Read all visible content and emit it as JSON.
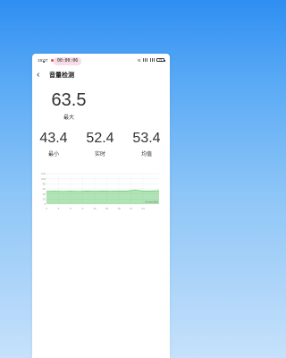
{
  "status_bar": {
    "time": "19:07",
    "icons": [
      "notification-icon",
      "nfc-icon",
      "wifi-icon",
      "signal-icon",
      "battery-icon"
    ],
    "battery": "73"
  },
  "header": {
    "back_icon": "chevron-left-icon",
    "title": "音量检测"
  },
  "timer": "00:00:06",
  "max": {
    "value": "63.5",
    "label": "最大"
  },
  "stats": [
    {
      "value": "43.4",
      "label": "最小"
    },
    {
      "value": "52.4",
      "label": "实时"
    },
    {
      "value": "53.4",
      "label": "均值"
    }
  ],
  "colors": {
    "accent": "#4fc45a",
    "timer_bg": "#f8dde7",
    "background_top": "#2f8ef2",
    "background_bottom": "#c6e1fb"
  },
  "chart_data": {
    "type": "area",
    "x": [
      0,
      2,
      4,
      6,
      8,
      10,
      12,
      14,
      16,
      18,
      20,
      22,
      24,
      26,
      28
    ],
    "values": [
      50,
      51,
      50,
      51,
      50,
      52,
      51,
      52,
      51,
      52,
      52,
      55,
      52,
      52,
      53
    ],
    "xticks": [
      "0",
      "3",
      "6",
      "9",
      "12",
      "15",
      "18",
      "21",
      "24"
    ],
    "yticks": [
      "120",
      "100",
      "80",
      "60",
      "40",
      "20",
      "0"
    ],
    "ylim": [
      0,
      120
    ],
    "xlim": [
      0,
      28
    ],
    "annotation": "Decibel(dB)",
    "grid": true,
    "color": "#4fc45a"
  }
}
